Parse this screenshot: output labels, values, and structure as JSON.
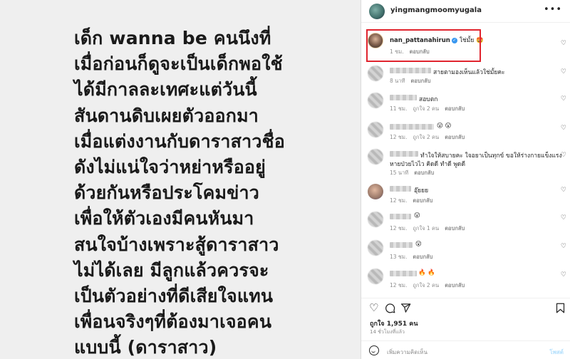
{
  "post_image": {
    "lines": [
      "เด็ก wanna be คนนึงที่",
      "เมื่อก่อนก็ดูจะเป็นเด็กพอใช้",
      "ได้มีกาลละเทศะแต่วันนี้",
      "สันดานดิบเผยตัวออกมา",
      "เมื่อแต่งงานกับดาราสาวชื่อ",
      "ดังไม่แน่ใจว่าหย่าหรืออยู่",
      "ด้วยกันหรือประโคมข่าว",
      "เพื่อให้ตัวเองมีคนหันมา",
      "สนใจบ้างเพราะสู้ดาราสาว",
      "ไม่ได้เลย มีลูกแล้วควรจะ",
      "เป็นตัวอย่างที่ดีเสียใจแทน",
      "เพื่อนจริงๆที่ต้องมาเจอคน",
      "แบบนี้ (ดาราสาว)"
    ]
  },
  "header": {
    "username": "yingmangmoomyugala",
    "more_icon": "more-horizontal-icon"
  },
  "comments": [
    {
      "name": "nan_pattanahirun",
      "verified": true,
      "text": "ใช่มั้ย 🤩",
      "time": "1 ชม.",
      "likes": "",
      "reply": "ตอบกลับ",
      "highlight": true
    },
    {
      "name": "",
      "text": "สายตามองเห็นแล้วใช่มั้ยคะ",
      "time": "8 นาที",
      "likes": "",
      "reply": "ตอบกลับ"
    },
    {
      "name": "",
      "text": "สอบตก",
      "time": "11 ชม.",
      "likes": "ถูกใจ 2 คน",
      "reply": "ตอบกลับ"
    },
    {
      "name": "",
      "text": "😮 😮",
      "time": "12 ชม.",
      "likes": "ถูกใจ 2 คน",
      "reply": "ตอบกลับ"
    },
    {
      "name": "",
      "text": "ทำใจให้สบายคะ ใจอยาเป็นทุกข์ ขอให้ร่างกายแข็งแรง",
      "text2": "หายป่วยไวไว คิดดี ทำดี พูดดี",
      "time": "15 นาที",
      "likes": "",
      "reply": "ตอบกลับ"
    },
    {
      "name": "",
      "text": "อุ๊ยยย",
      "time": "12 ชม.",
      "likes": "",
      "reply": "ตอบกลับ"
    },
    {
      "name": "",
      "text": "😮",
      "time": "12 ชม.",
      "likes": "ถูกใจ 1 คน",
      "reply": "ตอบกลับ"
    },
    {
      "name": "",
      "text": "😮",
      "time": "13 ชม.",
      "likes": "",
      "reply": "ตอบกลับ"
    },
    {
      "name": "",
      "text": "🔥 🔥",
      "time": "12 ชม.",
      "likes": "ถูกใจ 2 คน",
      "reply": "ตอบกลับ"
    }
  ],
  "actions": {
    "likes": "ถูกใจ 1,951 คน",
    "time_ago": "14 ชั่วโมงที่แล้ว",
    "add_comment_placeholder": "เพิ่มความคิดเห็น",
    "post_label": "โพสต์"
  },
  "colors": {
    "highlight": "#e0242e",
    "verified": "#3897f0",
    "post_button": "#b2dffc"
  }
}
